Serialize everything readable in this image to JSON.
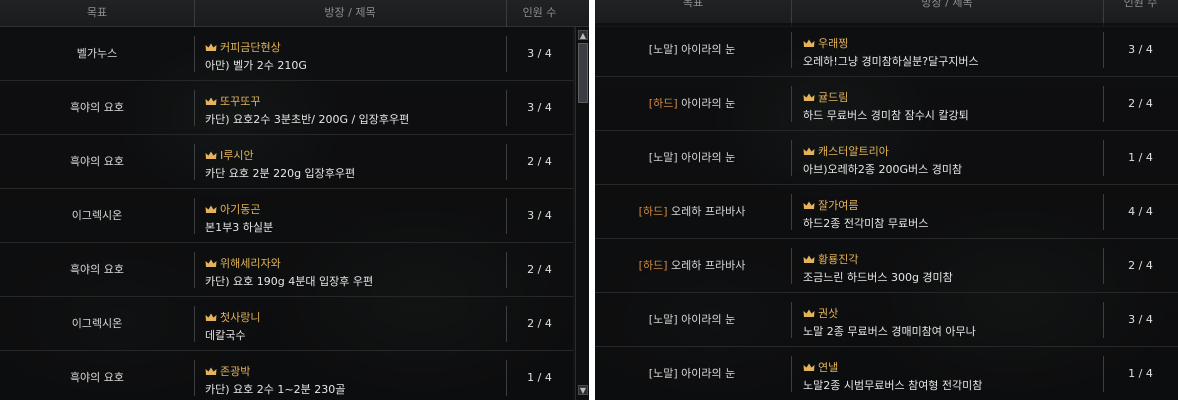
{
  "left": {
    "headers": {
      "target": "목표",
      "room": "방장 / 제목",
      "count": "인원 수"
    },
    "rows": [
      {
        "target": "벨가누스",
        "leader": "커피금단현상",
        "title": "아만) 벨가 2수 210G",
        "count": "3 / 4"
      },
      {
        "target": "흑야의 요호",
        "leader": "또꾸또꾸",
        "title": "카단) 요호2수 3분초반/ 200G / 입장후우편",
        "count": "3 / 4"
      },
      {
        "target": "흑야의 요호",
        "leader": "I루시안",
        "title": "카단 요호 2분 220g 입장후우편",
        "count": "2 / 4"
      },
      {
        "target": "이그렉시온",
        "leader": "아기동곤",
        "title": "본1부3 하실분",
        "count": "3 / 4"
      },
      {
        "target": "흑야의 요호",
        "leader": "위해세리자와",
        "title": "카단) 요호 190g 4분대 입장후 우편",
        "count": "2 / 4"
      },
      {
        "target": "이그렉시온",
        "leader": "첫사랑니",
        "title": "데칼국수",
        "count": "2 / 4"
      },
      {
        "target": "흑야의 요호",
        "leader": "존광박",
        "title": "카단) 요호 2수 1~2분 230골",
        "count": "1 / 4"
      }
    ]
  },
  "right": {
    "headers": {
      "target": "목표",
      "room": "방장 / 제목",
      "count": "인원 수"
    },
    "rows": [
      {
        "tag": "[노말]",
        "tag_type": "normal",
        "target": "아이라의 눈",
        "leader": "우래찡",
        "title": "오레하!그냥 경미참하실분?달구지버스",
        "count": "3 / 4"
      },
      {
        "tag": "[하드]",
        "tag_type": "hard",
        "target": "아이라의 눈",
        "leader": "귤드림",
        "title": "하드 무료버스 경미참 잠수시 칼강퇴",
        "count": "2 / 4"
      },
      {
        "tag": "[노말]",
        "tag_type": "normal",
        "target": "아이라의 눈",
        "leader": "캐스터알트리아",
        "title": "아브)오레하2종 200G버스 경미참",
        "count": "1 / 4"
      },
      {
        "tag": "[하드]",
        "tag_type": "hard",
        "target": "오레하 프라바사",
        "leader": "잘가여름",
        "title": "하드2종 전각미참 무료버스",
        "count": "4 / 4"
      },
      {
        "tag": "[하드]",
        "tag_type": "hard",
        "target": "오레하 프라바사",
        "leader": "황룡진각",
        "title": "조금느린 하드버스 300g 경미참",
        "count": "2 / 4"
      },
      {
        "tag": "[노말]",
        "tag_type": "normal",
        "target": "아이라의 눈",
        "leader": "권삿",
        "title": "노말 2종 무료버스 경매미참여 아무나",
        "count": "3 / 4"
      },
      {
        "tag": "[노말]",
        "tag_type": "normal",
        "target": "아이라의 눈",
        "leader": "연낼",
        "title": "노말2종 시범무료버스 참여형 전각미참",
        "count": "1 / 4"
      }
    ]
  },
  "colors": {
    "leader": "#e3b25a",
    "hard_tag": "#d08a45",
    "background": "#151617"
  },
  "icons": {
    "leader_icon": "crown-icon",
    "scroll_up": "arrow-up-icon",
    "scroll_down": "arrow-down-icon"
  }
}
